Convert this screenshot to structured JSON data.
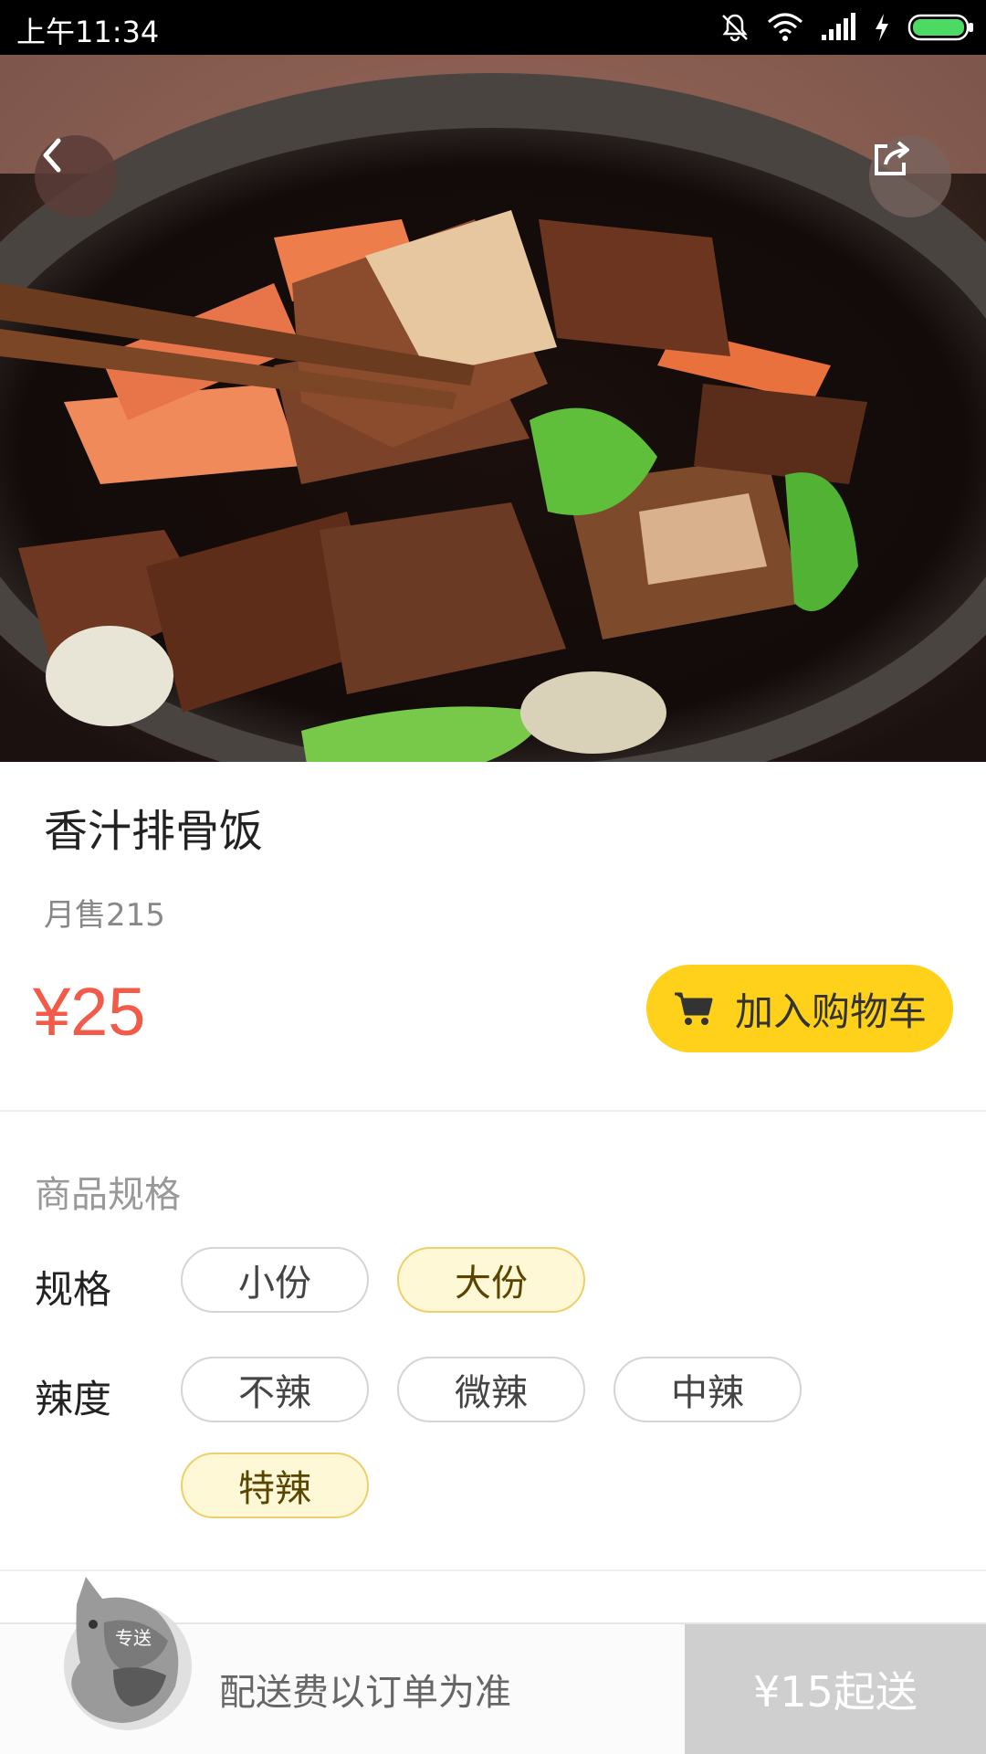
{
  "status_bar": {
    "time": "上午11:34",
    "icons": [
      "bell-muted-icon",
      "wifi-icon",
      "signal-icon",
      "charging-icon",
      "battery-icon"
    ]
  },
  "hero": {
    "image_description_icon": "food-photo",
    "back_icon": "chevron-left-icon",
    "share_icon": "share-icon"
  },
  "product": {
    "name": "香汁排骨饭",
    "monthly_sales": "月售215",
    "price": "¥25",
    "add_to_cart_label": "加入购物车",
    "add_to_cart_color": "#ffd11a",
    "price_color": "#f25a4a"
  },
  "specs": {
    "heading": "商品规格",
    "size": {
      "label": "规格",
      "options": [
        {
          "label": "小份",
          "selected": false
        },
        {
          "label": "大份",
          "selected": true
        }
      ]
    },
    "spice": {
      "label": "辣度",
      "options": [
        {
          "label": "不辣",
          "selected": false
        },
        {
          "label": "微辣",
          "selected": false
        },
        {
          "label": "中辣",
          "selected": false
        },
        {
          "label": "特辣",
          "selected": true
        }
      ]
    }
  },
  "bottom_bar": {
    "mascot_badge": "专送",
    "delivery_note": "配送费以订单为准",
    "min_order": "¥15起送"
  }
}
